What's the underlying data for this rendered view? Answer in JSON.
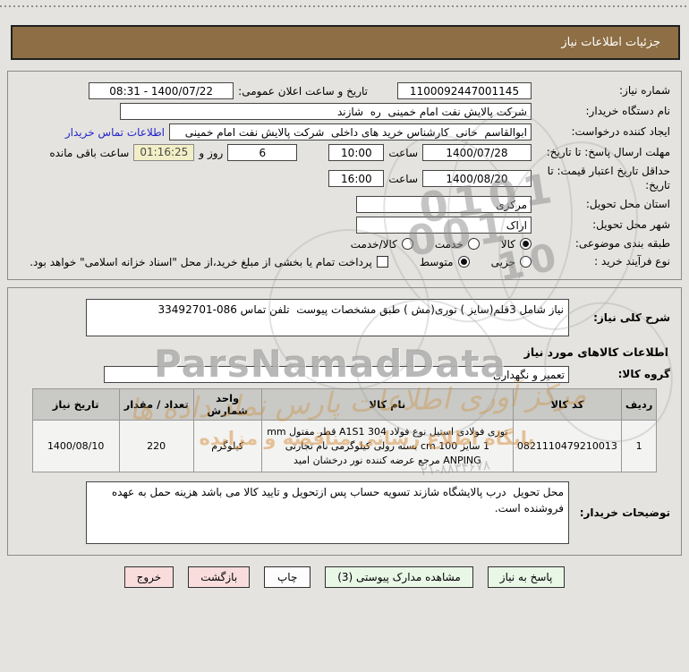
{
  "title_bar": {
    "label": "جزئیات اطلاعات نیاز"
  },
  "form": {
    "need_number_label": "شماره نیاز:",
    "need_number": "1100092447001145",
    "announce_label": "تاریخ و ساعت اعلان عمومی:",
    "announce_value": "1400/07/22 - 08:31",
    "buyer_org_label": "نام دستگاه خریدار:",
    "buyer_org": "شرکت پالایش نفت امام خمینی  ره  شازند",
    "creator_label": "ایجاد کننده درخواست:",
    "creator": "ابوالقاسم  خانی  کارشناس خرید های داخلی  شرکت پالایش نفت امام خمینی",
    "contact_link": "اطلاعات تماس خریدار",
    "deadline_label": "مهلت ارسال پاسخ: تا تاریخ:",
    "deadline_date": "1400/07/28",
    "hour_label": "ساعت",
    "deadline_time": "10:00",
    "days_value": "6",
    "days_and_label": "روز و",
    "countdown": "01:16:25",
    "remaining_label": "ساعت باقی مانده",
    "validity_label": "حداقل تاریخ اعتبار قیمت: تا تاریخ:",
    "validity_date": "1400/08/20",
    "validity_time": "16:00",
    "province_label": "استان محل تحویل:",
    "province": "مرکزی",
    "city_label": "شهر محل تحویل:",
    "city": "اراک",
    "classification_label": "طبقه بندی موضوعی:",
    "class_opt1": "کالا",
    "class_opt2": "خدمت",
    "class_opt3": "کالا/خدمت",
    "process_label": "نوع فرآیند خرید :",
    "process_opt1": "جزیی",
    "process_opt2": "متوسط",
    "treasury_checkbox_label": "پرداخت تمام یا بخشی از مبلغ خرید،از محل \"اسناد خزانه اسلامی\" خواهد بود."
  },
  "details": {
    "desc_label": "شرح کلی نیاز:",
    "desc_value": "نیاز شامل 3قلم(سایز ) توری(مش ) طبق مشخصات پیوست  تلفن تماس 086-33492701",
    "goods_title": "اطلاعات کالاهای مورد نیاز",
    "group_label": "گروه کالا:",
    "group_value": "تعمیر و نگهداری",
    "table": {
      "headers": [
        "ردیف",
        "کد کالا",
        "نام کالا",
        "واحد شمارش",
        "تعداد / مقدار",
        "تاریخ نیاز"
      ],
      "rows": [
        {
          "index": "1",
          "code": "0821110479210013",
          "name": "توری فولادی استیل نوع فولاد A1S1 304 قطر مفتول mm 1 سایز cm 100 بسته رولی کیلوگرمی نام تجارتی ANPING مرجع عرضه کننده نور درخشان امید",
          "unit": "کیلوگرم",
          "qty": "220",
          "need_date": "1400/08/10"
        }
      ]
    },
    "notes_label": "توضیحات خریدار:",
    "notes_value": "محل تحویل  درب پالایشگاه شازند تسویه حساب پس ازتحویل و تایید کالا می باشد هزینه حمل به عهده فروشنده است."
  },
  "buttons": {
    "reply": "پاسخ به نیاز",
    "view_docs": "مشاهده مدارک پیوستی (3)",
    "print": "چاپ",
    "back": "بازگشت",
    "exit": "خروج"
  },
  "watermarks": {
    "digits_1": "0101",
    "digits_2": "001",
    "digits_3": "10",
    "brand_en": "ParsNamadData",
    "brand_fa": "مرکز آوری اطلاعات پارس نماد داده ها",
    "tagline_fa": "پایگاه اطلاع رسانی مناقصه و مزایده",
    "phone_fa": "۲۱-۸۸۳۴۶۷۸"
  },
  "colors": {
    "title_bar_bg": "#8d6e45",
    "button_green": "#e9f7e7",
    "button_pink": "#f9dddd",
    "countdown_bg": "#f2efc8",
    "link_blue": "#2323cc"
  }
}
